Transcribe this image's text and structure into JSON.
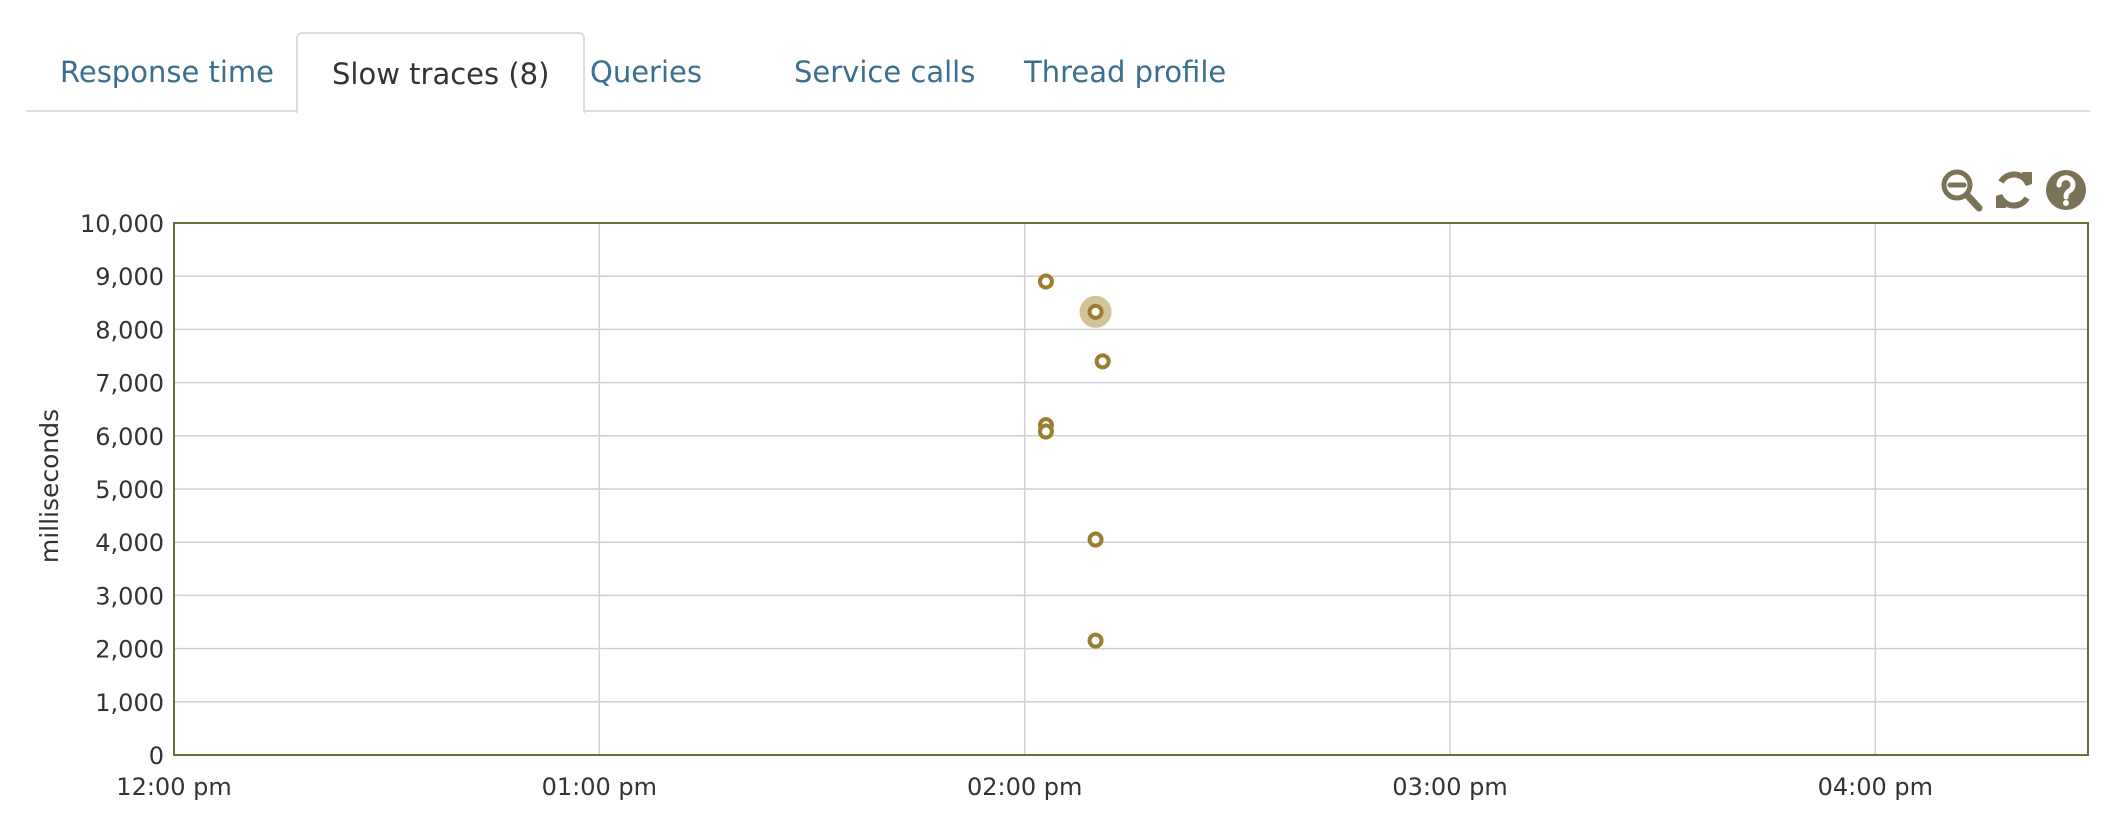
{
  "tabs": [
    {
      "label": "Response time",
      "active": false
    },
    {
      "label": "Slow traces (8)",
      "active": true
    },
    {
      "label": "Queries",
      "active": false
    },
    {
      "label": "Service calls",
      "active": false
    },
    {
      "label": "Thread profile",
      "active": false
    }
  ],
  "toolbar": {
    "zoom_out_icon": "magnifier-minus-icon",
    "refresh_icon": "refresh-icon",
    "help_icon": "question-circle-icon"
  },
  "colors": {
    "point": "#9b7d2e",
    "highlight": "#c9b47e",
    "axis": "#6e6a3a",
    "grid": "#d0d0d0",
    "tab_link": "#3b6e8f",
    "icon": "#7a7358"
  },
  "chart_data": {
    "type": "scatter",
    "title": "",
    "xlabel": "",
    "ylabel": "milliseconds",
    "x_ticks": [
      "12:00 pm",
      "01:00 pm",
      "02:00 pm",
      "03:00 pm",
      "04:00 pm"
    ],
    "y_ticks": [
      "0",
      "1,000",
      "2,000",
      "3,000",
      "4,000",
      "5,000",
      "6,000",
      "7,000",
      "8,000",
      "9,000",
      "10,000"
    ],
    "xlim": [
      "12:00 pm",
      "04:30 pm"
    ],
    "ylim": [
      0,
      10000
    ],
    "grid": true,
    "series": [
      {
        "points": [
          {
            "x": "02:03 pm",
            "y": 8900
          },
          {
            "x": "02:10 pm",
            "y": 8330,
            "highlighted": true
          },
          {
            "x": "02:11 pm",
            "y": 7400
          },
          {
            "x": "02:03 pm",
            "y": 6200
          },
          {
            "x": "02:03 pm",
            "y": 6080
          },
          {
            "x": "02:10 pm",
            "y": 4050
          },
          {
            "x": "02:10 pm",
            "y": 2150
          }
        ]
      }
    ]
  }
}
